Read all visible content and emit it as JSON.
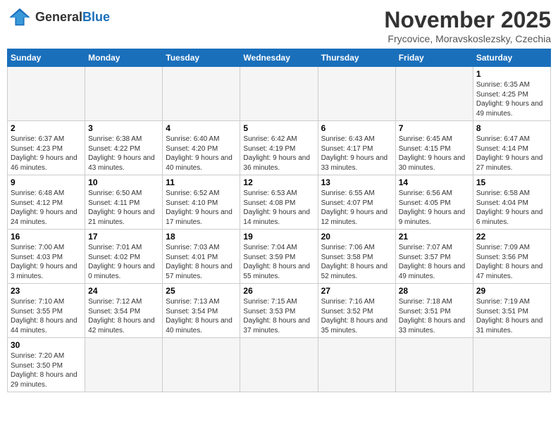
{
  "logo": {
    "general": "General",
    "blue": "Blue"
  },
  "title": "November 2025",
  "location": "Frycovice, Moravskoslezsky, Czechia",
  "days_of_week": [
    "Sunday",
    "Monday",
    "Tuesday",
    "Wednesday",
    "Thursday",
    "Friday",
    "Saturday"
  ],
  "weeks": [
    [
      {
        "day": "",
        "info": ""
      },
      {
        "day": "",
        "info": ""
      },
      {
        "day": "",
        "info": ""
      },
      {
        "day": "",
        "info": ""
      },
      {
        "day": "",
        "info": ""
      },
      {
        "day": "",
        "info": ""
      },
      {
        "day": "1",
        "info": "Sunrise: 6:35 AM\nSunset: 4:25 PM\nDaylight: 9 hours and 49 minutes."
      }
    ],
    [
      {
        "day": "2",
        "info": "Sunrise: 6:37 AM\nSunset: 4:23 PM\nDaylight: 9 hours and 46 minutes."
      },
      {
        "day": "3",
        "info": "Sunrise: 6:38 AM\nSunset: 4:22 PM\nDaylight: 9 hours and 43 minutes."
      },
      {
        "day": "4",
        "info": "Sunrise: 6:40 AM\nSunset: 4:20 PM\nDaylight: 9 hours and 40 minutes."
      },
      {
        "day": "5",
        "info": "Sunrise: 6:42 AM\nSunset: 4:19 PM\nDaylight: 9 hours and 36 minutes."
      },
      {
        "day": "6",
        "info": "Sunrise: 6:43 AM\nSunset: 4:17 PM\nDaylight: 9 hours and 33 minutes."
      },
      {
        "day": "7",
        "info": "Sunrise: 6:45 AM\nSunset: 4:15 PM\nDaylight: 9 hours and 30 minutes."
      },
      {
        "day": "8",
        "info": "Sunrise: 6:47 AM\nSunset: 4:14 PM\nDaylight: 9 hours and 27 minutes."
      }
    ],
    [
      {
        "day": "9",
        "info": "Sunrise: 6:48 AM\nSunset: 4:12 PM\nDaylight: 9 hours and 24 minutes."
      },
      {
        "day": "10",
        "info": "Sunrise: 6:50 AM\nSunset: 4:11 PM\nDaylight: 9 hours and 21 minutes."
      },
      {
        "day": "11",
        "info": "Sunrise: 6:52 AM\nSunset: 4:10 PM\nDaylight: 9 hours and 17 minutes."
      },
      {
        "day": "12",
        "info": "Sunrise: 6:53 AM\nSunset: 4:08 PM\nDaylight: 9 hours and 14 minutes."
      },
      {
        "day": "13",
        "info": "Sunrise: 6:55 AM\nSunset: 4:07 PM\nDaylight: 9 hours and 12 minutes."
      },
      {
        "day": "14",
        "info": "Sunrise: 6:56 AM\nSunset: 4:05 PM\nDaylight: 9 hours and 9 minutes."
      },
      {
        "day": "15",
        "info": "Sunrise: 6:58 AM\nSunset: 4:04 PM\nDaylight: 9 hours and 6 minutes."
      }
    ],
    [
      {
        "day": "16",
        "info": "Sunrise: 7:00 AM\nSunset: 4:03 PM\nDaylight: 9 hours and 3 minutes."
      },
      {
        "day": "17",
        "info": "Sunrise: 7:01 AM\nSunset: 4:02 PM\nDaylight: 9 hours and 0 minutes."
      },
      {
        "day": "18",
        "info": "Sunrise: 7:03 AM\nSunset: 4:01 PM\nDaylight: 8 hours and 57 minutes."
      },
      {
        "day": "19",
        "info": "Sunrise: 7:04 AM\nSunset: 3:59 PM\nDaylight: 8 hours and 55 minutes."
      },
      {
        "day": "20",
        "info": "Sunrise: 7:06 AM\nSunset: 3:58 PM\nDaylight: 8 hours and 52 minutes."
      },
      {
        "day": "21",
        "info": "Sunrise: 7:07 AM\nSunset: 3:57 PM\nDaylight: 8 hours and 49 minutes."
      },
      {
        "day": "22",
        "info": "Sunrise: 7:09 AM\nSunset: 3:56 PM\nDaylight: 8 hours and 47 minutes."
      }
    ],
    [
      {
        "day": "23",
        "info": "Sunrise: 7:10 AM\nSunset: 3:55 PM\nDaylight: 8 hours and 44 minutes."
      },
      {
        "day": "24",
        "info": "Sunrise: 7:12 AM\nSunset: 3:54 PM\nDaylight: 8 hours and 42 minutes."
      },
      {
        "day": "25",
        "info": "Sunrise: 7:13 AM\nSunset: 3:54 PM\nDaylight: 8 hours and 40 minutes."
      },
      {
        "day": "26",
        "info": "Sunrise: 7:15 AM\nSunset: 3:53 PM\nDaylight: 8 hours and 37 minutes."
      },
      {
        "day": "27",
        "info": "Sunrise: 7:16 AM\nSunset: 3:52 PM\nDaylight: 8 hours and 35 minutes."
      },
      {
        "day": "28",
        "info": "Sunrise: 7:18 AM\nSunset: 3:51 PM\nDaylight: 8 hours and 33 minutes."
      },
      {
        "day": "29",
        "info": "Sunrise: 7:19 AM\nSunset: 3:51 PM\nDaylight: 8 hours and 31 minutes."
      }
    ],
    [
      {
        "day": "30",
        "info": "Sunrise: 7:20 AM\nSunset: 3:50 PM\nDaylight: 8 hours and 29 minutes."
      },
      {
        "day": "",
        "info": ""
      },
      {
        "day": "",
        "info": ""
      },
      {
        "day": "",
        "info": ""
      },
      {
        "day": "",
        "info": ""
      },
      {
        "day": "",
        "info": ""
      },
      {
        "day": "",
        "info": ""
      }
    ]
  ]
}
